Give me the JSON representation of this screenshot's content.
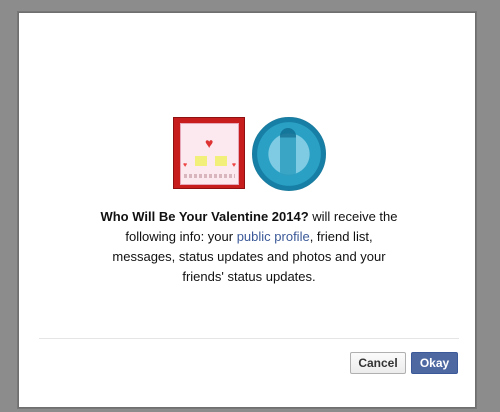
{
  "dialog": {
    "app_name": "Who Will Be Your Valentine 2014?",
    "message_part1": " will receive the following info: your ",
    "link_public_profile": "public profile",
    "message_part2": ", friend list, messages, status updates and photos and your friends' status updates.",
    "cancel_label": "Cancel",
    "okay_label": "Okay"
  },
  "colors": {
    "overlay": "#8c8c8c",
    "link": "#3b5998",
    "primary_button": "#4e69a2"
  },
  "icons": {
    "app": "valentine-app-icon",
    "user": "profile-picture"
  }
}
